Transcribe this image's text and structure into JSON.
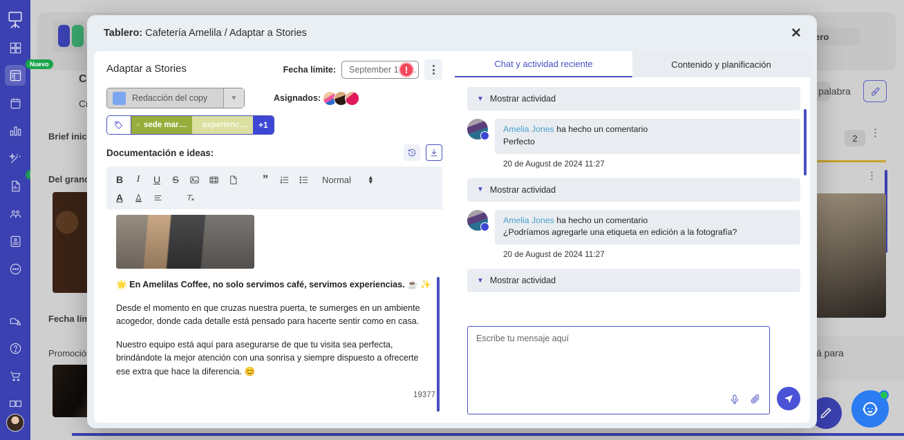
{
  "background": {
    "sidebar": {
      "logo_icon": "easel-logo-icon",
      "items": [
        {
          "name": "grid-icon",
          "badge": ""
        },
        {
          "name": "board-icon",
          "badge": "Nuevo",
          "active": true
        },
        {
          "name": "calendar-icon",
          "badge": ""
        },
        {
          "name": "bar-chart-icon",
          "badge": ""
        },
        {
          "name": "magic-wand-icon",
          "badge": ""
        },
        {
          "name": "report-doc-icon",
          "badge": "Nuevo"
        },
        {
          "name": "team-icon",
          "badge": ""
        },
        {
          "name": "contact-card-icon",
          "badge": ""
        },
        {
          "name": "chat-bubble-icon",
          "badge": ""
        }
      ],
      "bottom_items": [
        {
          "name": "upload-alert-icon"
        },
        {
          "name": "help-circle-icon"
        },
        {
          "name": "cart-icon"
        },
        {
          "name": "ab-test-icon"
        }
      ]
    },
    "board": {
      "project_title": "Cafete",
      "project_subtitle": "Creaci",
      "column_1": "Brief inicia",
      "column_2": "Del grano a",
      "column_3": "Fecha límite",
      "column_4": "Promoción ",
      "top_right_pill": "tablero",
      "search_pill": "por palabra",
      "broom_icon": "broom-icon",
      "card_count": "2",
      "card_text": "á para"
    },
    "fabs": {
      "edit_icon": "pencil-icon",
      "support_icon": "support-agent-icon"
    }
  },
  "modal": {
    "header": {
      "title_prefix": "Tablero:",
      "title_text": " Cafetería Amelila / Adaptar a Stories",
      "close_label": "✕"
    },
    "left": {
      "task_title": "Adaptar a Stories",
      "deadline_label": "Fecha límite:",
      "deadline_value": "September 1, 2…",
      "deadline_warning": "!",
      "more_menu_icon": "kebab-menu-icon",
      "status_value": "Redacción del copy",
      "status_color": "#7ba7f0",
      "assignees_label": "Asignados:",
      "assignees": [
        "Avatar 1",
        "Avatar 2",
        "Avatar 3"
      ],
      "tags": [
        {
          "label": "sede mar…",
          "color": "#98ae3c"
        },
        {
          "label": "experienc…",
          "color": "#dbe0a0"
        }
      ],
      "tags_more": "+1",
      "docs_title": "Documentación e ideas:",
      "history_icon": "history-icon",
      "download_icon": "download-icon",
      "toolbar": {
        "bold": "B",
        "italic": "I",
        "underline": "U",
        "strikethrough": "S",
        "image_icon": "image-icon",
        "video_icon": "video-icon",
        "file_icon": "file-icon",
        "quote": "”",
        "ordered_list_icon": "ordered-list-icon",
        "bullet_list_icon": "bullet-list-icon",
        "format_value": "Normal",
        "text_color": "A",
        "highlight_icon": "highlight-icon",
        "align_icon": "align-icon",
        "clear_format_icon": "clear-format-icon"
      },
      "content": {
        "image_alt": "Barista pouring coffee at counter",
        "heading": "🌟 En Amelilas Coffee, no solo servimos café, servimos experiencias. ☕ ✨",
        "paragraph_1": "Desde el momento en que cruzas nuestra puerta, te sumerges en un ambiente acogedor, donde cada detalle está pensado para hacerte sentir como en casa.",
        "paragraph_2": "Nuestro equipo está aquí para asegurarse de que tu visita sea perfecta, brindándote la mejor atención con una sonrisa y siempre dispuesto a ofrecerte ese extra que hace la diferencia. 😊",
        "char_count": "19377"
      }
    },
    "right": {
      "tabs": [
        {
          "label": "Chat y actividad reciente",
          "active": true
        },
        {
          "label": "Contenido y planificación",
          "active": false
        }
      ],
      "activity_toggle_label": "Mostrar actividad",
      "comments": [
        {
          "author": "Amelia Jones",
          "action": "ha hecho un comentario",
          "text": "Perfecto",
          "timestamp": "20 de August de 2024 11:27"
        },
        {
          "author": "Amelia Jones",
          "action": "ha hecho un comentario",
          "text": "¿Podríamos agregarle una etiqueta en edición a la fotografía?",
          "timestamp": "20 de August de 2024 11:27"
        }
      ],
      "composer": {
        "placeholder": "Escribe tu mensaje aquí",
        "mic_icon": "microphone-icon",
        "attach_icon": "paperclip-icon",
        "send_icon": "send-icon"
      }
    }
  }
}
